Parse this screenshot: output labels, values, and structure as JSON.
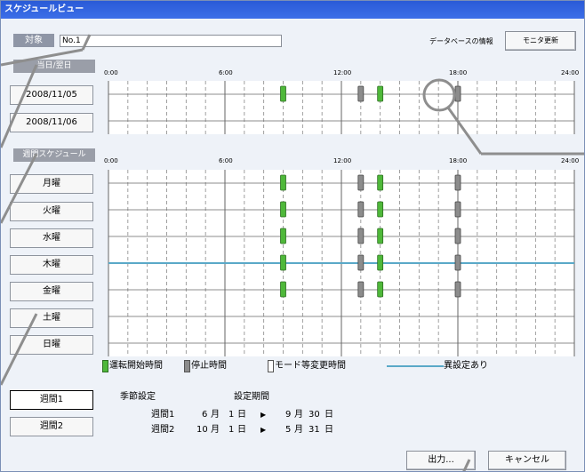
{
  "window": {
    "title": "スケジュールビュー"
  },
  "target": {
    "label": "対象",
    "value": "No.1"
  },
  "header": {
    "db_info_label": "データベースの情報",
    "refresh_label": "モニタ更新"
  },
  "time_axis": {
    "ticks": [
      "0:00",
      "6:00",
      "12:00",
      "18:00",
      "24:00"
    ]
  },
  "day_section": {
    "label": "当日/翌日",
    "rows": [
      {
        "label": "2008/11/05",
        "events": [
          {
            "kind": "start",
            "hour": 9.0
          },
          {
            "kind": "stop",
            "hour": 13.0
          },
          {
            "kind": "start",
            "hour": 14.0
          },
          {
            "kind": "stop",
            "hour": 18.0
          }
        ]
      },
      {
        "label": "2008/11/06",
        "events": []
      }
    ]
  },
  "week_section": {
    "label": "週間スケジュール",
    "rows": [
      {
        "label": "月曜",
        "events": [
          {
            "kind": "start",
            "hour": 9.0
          },
          {
            "kind": "stop",
            "hour": 13.0
          },
          {
            "kind": "start",
            "hour": 14.0
          },
          {
            "kind": "stop",
            "hour": 18.0
          }
        ],
        "abnormal": false
      },
      {
        "label": "火曜",
        "events": [
          {
            "kind": "start",
            "hour": 9.0
          },
          {
            "kind": "stop",
            "hour": 13.0
          },
          {
            "kind": "start",
            "hour": 14.0
          },
          {
            "kind": "stop",
            "hour": 18.0
          }
        ],
        "abnormal": false
      },
      {
        "label": "水曜",
        "events": [
          {
            "kind": "start",
            "hour": 9.0
          },
          {
            "kind": "stop",
            "hour": 13.0
          },
          {
            "kind": "start",
            "hour": 14.0
          },
          {
            "kind": "stop",
            "hour": 18.0
          }
        ],
        "abnormal": false
      },
      {
        "label": "木曜",
        "events": [
          {
            "kind": "start",
            "hour": 9.0
          },
          {
            "kind": "stop",
            "hour": 13.0
          },
          {
            "kind": "start",
            "hour": 14.0
          },
          {
            "kind": "stop",
            "hour": 18.0
          }
        ],
        "abnormal": true
      },
      {
        "label": "金曜",
        "events": [
          {
            "kind": "start",
            "hour": 9.0
          },
          {
            "kind": "stop",
            "hour": 13.0
          },
          {
            "kind": "start",
            "hour": 14.0
          },
          {
            "kind": "stop",
            "hour": 18.0
          }
        ],
        "abnormal": false
      },
      {
        "label": "土曜",
        "events": [],
        "abnormal": false
      },
      {
        "label": "日曜",
        "events": [],
        "abnormal": false
      }
    ]
  },
  "legend": {
    "start": "運転開始時間",
    "stop": "停止時間",
    "mode": "モード等変更時間",
    "abnormal": "異設定あり"
  },
  "colors": {
    "start": "#4fb83a",
    "stop": "#8c8c8c",
    "abnormal_line": "#5aa9c8"
  },
  "season": {
    "week1_button": "週間1",
    "week2_button": "週間2",
    "title": "季節設定",
    "period_title": "設定期間",
    "periods": [
      {
        "name": "週間1",
        "from_month": "6",
        "from_day": "1",
        "to_month": "9",
        "to_day": "30"
      },
      {
        "name": "週間2",
        "from_month": "10",
        "from_day": "1",
        "to_month": "5",
        "to_day": "31"
      }
    ],
    "month_unit": "月",
    "day_unit": "日",
    "arrow": "▶"
  },
  "footer": {
    "output_label": "出力...",
    "cancel_label": "キャンセル"
  }
}
